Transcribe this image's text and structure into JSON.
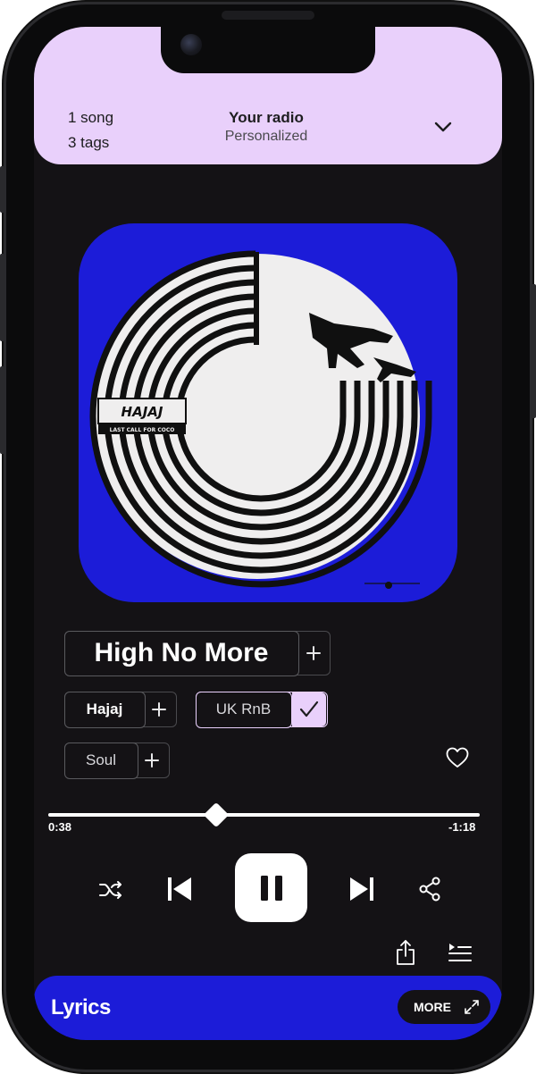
{
  "header": {
    "song_count": "1 song",
    "tag_count": "3 tags",
    "title": "Your radio",
    "subtitle": "Personalized"
  },
  "album": {
    "artist_logo": "HAJAJ",
    "album_subtitle": "LAST CALL FOR COCO",
    "background_color": "#1c1cd8"
  },
  "track": {
    "title": "High No More",
    "artist": "Hajaj",
    "tags": [
      {
        "label": "UK RnB",
        "selected": true
      },
      {
        "label": "Soul",
        "selected": false
      }
    ]
  },
  "player": {
    "elapsed": "0:38",
    "remaining": "-1:18",
    "progress": 0.39
  },
  "icons": {
    "chevron": "chevron-down-icon",
    "plus": "plus-icon",
    "check": "check-icon",
    "heart": "heart-icon",
    "shuffle": "shuffle-icon",
    "previous": "skip-previous-icon",
    "pause": "pause-icon",
    "next": "skip-next-icon",
    "share": "share-icon",
    "export": "export-icon",
    "queue": "queue-icon",
    "expand": "expand-icon"
  },
  "lyrics": {
    "title": "Lyrics",
    "more_label": "MORE"
  },
  "colors": {
    "header_bg": "#e9d0fb",
    "accent_blue": "#1c1cd8",
    "screen_bg": "#141215",
    "selected_tag_check_bg": "#e9d0fb"
  }
}
